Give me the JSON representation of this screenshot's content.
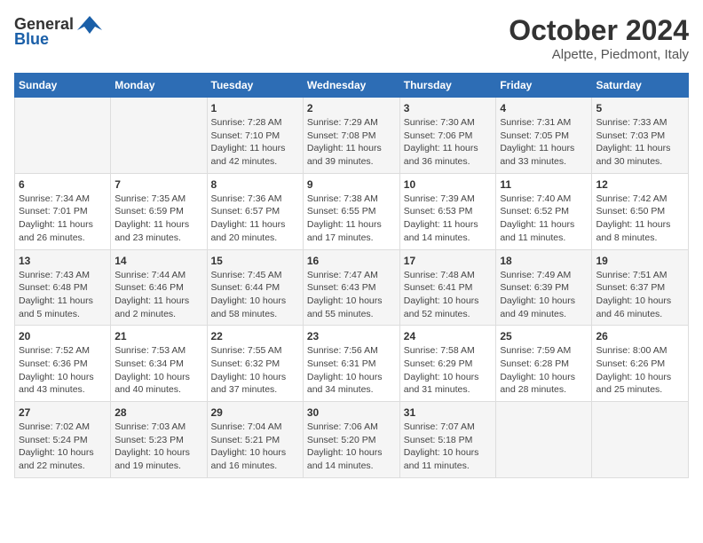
{
  "header": {
    "logo_general": "General",
    "logo_blue": "Blue",
    "month_title": "October 2024",
    "location": "Alpette, Piedmont, Italy"
  },
  "days_of_week": [
    "Sunday",
    "Monday",
    "Tuesday",
    "Wednesday",
    "Thursday",
    "Friday",
    "Saturday"
  ],
  "weeks": [
    [
      {
        "day": "",
        "info": ""
      },
      {
        "day": "",
        "info": ""
      },
      {
        "day": "1",
        "info": "Sunrise: 7:28 AM\nSunset: 7:10 PM\nDaylight: 11 hours\nand 42 minutes."
      },
      {
        "day": "2",
        "info": "Sunrise: 7:29 AM\nSunset: 7:08 PM\nDaylight: 11 hours\nand 39 minutes."
      },
      {
        "day": "3",
        "info": "Sunrise: 7:30 AM\nSunset: 7:06 PM\nDaylight: 11 hours\nand 36 minutes."
      },
      {
        "day": "4",
        "info": "Sunrise: 7:31 AM\nSunset: 7:05 PM\nDaylight: 11 hours\nand 33 minutes."
      },
      {
        "day": "5",
        "info": "Sunrise: 7:33 AM\nSunset: 7:03 PM\nDaylight: 11 hours\nand 30 minutes."
      }
    ],
    [
      {
        "day": "6",
        "info": "Sunrise: 7:34 AM\nSunset: 7:01 PM\nDaylight: 11 hours\nand 26 minutes."
      },
      {
        "day": "7",
        "info": "Sunrise: 7:35 AM\nSunset: 6:59 PM\nDaylight: 11 hours\nand 23 minutes."
      },
      {
        "day": "8",
        "info": "Sunrise: 7:36 AM\nSunset: 6:57 PM\nDaylight: 11 hours\nand 20 minutes."
      },
      {
        "day": "9",
        "info": "Sunrise: 7:38 AM\nSunset: 6:55 PM\nDaylight: 11 hours\nand 17 minutes."
      },
      {
        "day": "10",
        "info": "Sunrise: 7:39 AM\nSunset: 6:53 PM\nDaylight: 11 hours\nand 14 minutes."
      },
      {
        "day": "11",
        "info": "Sunrise: 7:40 AM\nSunset: 6:52 PM\nDaylight: 11 hours\nand 11 minutes."
      },
      {
        "day": "12",
        "info": "Sunrise: 7:42 AM\nSunset: 6:50 PM\nDaylight: 11 hours\nand 8 minutes."
      }
    ],
    [
      {
        "day": "13",
        "info": "Sunrise: 7:43 AM\nSunset: 6:48 PM\nDaylight: 11 hours\nand 5 minutes."
      },
      {
        "day": "14",
        "info": "Sunrise: 7:44 AM\nSunset: 6:46 PM\nDaylight: 11 hours\nand 2 minutes."
      },
      {
        "day": "15",
        "info": "Sunrise: 7:45 AM\nSunset: 6:44 PM\nDaylight: 10 hours\nand 58 minutes."
      },
      {
        "day": "16",
        "info": "Sunrise: 7:47 AM\nSunset: 6:43 PM\nDaylight: 10 hours\nand 55 minutes."
      },
      {
        "day": "17",
        "info": "Sunrise: 7:48 AM\nSunset: 6:41 PM\nDaylight: 10 hours\nand 52 minutes."
      },
      {
        "day": "18",
        "info": "Sunrise: 7:49 AM\nSunset: 6:39 PM\nDaylight: 10 hours\nand 49 minutes."
      },
      {
        "day": "19",
        "info": "Sunrise: 7:51 AM\nSunset: 6:37 PM\nDaylight: 10 hours\nand 46 minutes."
      }
    ],
    [
      {
        "day": "20",
        "info": "Sunrise: 7:52 AM\nSunset: 6:36 PM\nDaylight: 10 hours\nand 43 minutes."
      },
      {
        "day": "21",
        "info": "Sunrise: 7:53 AM\nSunset: 6:34 PM\nDaylight: 10 hours\nand 40 minutes."
      },
      {
        "day": "22",
        "info": "Sunrise: 7:55 AM\nSunset: 6:32 PM\nDaylight: 10 hours\nand 37 minutes."
      },
      {
        "day": "23",
        "info": "Sunrise: 7:56 AM\nSunset: 6:31 PM\nDaylight: 10 hours\nand 34 minutes."
      },
      {
        "day": "24",
        "info": "Sunrise: 7:58 AM\nSunset: 6:29 PM\nDaylight: 10 hours\nand 31 minutes."
      },
      {
        "day": "25",
        "info": "Sunrise: 7:59 AM\nSunset: 6:28 PM\nDaylight: 10 hours\nand 28 minutes."
      },
      {
        "day": "26",
        "info": "Sunrise: 8:00 AM\nSunset: 6:26 PM\nDaylight: 10 hours\nand 25 minutes."
      }
    ],
    [
      {
        "day": "27",
        "info": "Sunrise: 7:02 AM\nSunset: 5:24 PM\nDaylight: 10 hours\nand 22 minutes."
      },
      {
        "day": "28",
        "info": "Sunrise: 7:03 AM\nSunset: 5:23 PM\nDaylight: 10 hours\nand 19 minutes."
      },
      {
        "day": "29",
        "info": "Sunrise: 7:04 AM\nSunset: 5:21 PM\nDaylight: 10 hours\nand 16 minutes."
      },
      {
        "day": "30",
        "info": "Sunrise: 7:06 AM\nSunset: 5:20 PM\nDaylight: 10 hours\nand 14 minutes."
      },
      {
        "day": "31",
        "info": "Sunrise: 7:07 AM\nSunset: 5:18 PM\nDaylight: 10 hours\nand 11 minutes."
      },
      {
        "day": "",
        "info": ""
      },
      {
        "day": "",
        "info": ""
      }
    ]
  ]
}
